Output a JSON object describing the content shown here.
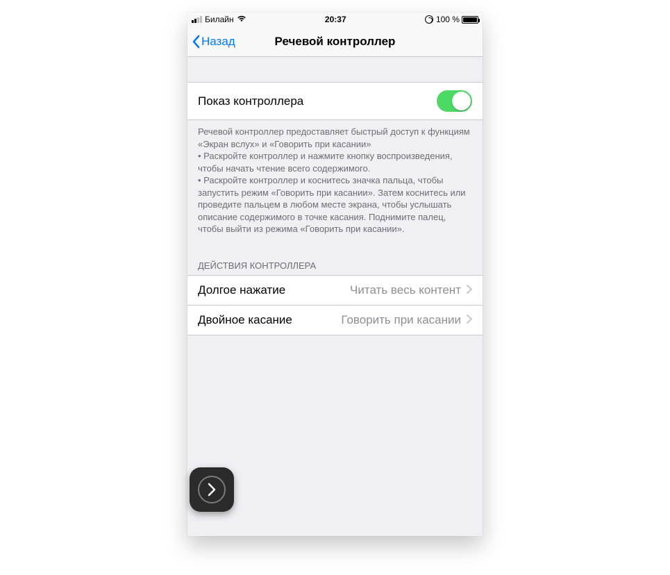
{
  "status": {
    "carrier": "Билайн",
    "time": "20:37",
    "battery_text": "100 %"
  },
  "nav": {
    "back": "Назад",
    "title": "Речевой контроллер"
  },
  "toggle": {
    "label": "Показ контроллера",
    "on": true
  },
  "description": "Речевой контроллер предоставляет быстрый доступ к функциям «Экран вслух» и «Говорить при касании»\n • Раскройте контроллер и нажмите кнопку воспроизведения, чтобы начать чтение всего содержимого.\n • Раскройте контроллер и коснитесь значка пальца, чтобы запустить режим «Говорить при касании». Затем коснитесь или проведите пальцем в любом месте экрана, чтобы услышать описание содержимого в точке касания. Поднимите палец, чтобы выйти из режима «Говорить при касании».",
  "section_header": "ДЕЙСТВИЯ КОНТРОЛЛЕРА",
  "actions": [
    {
      "label": "Долгое нажатие",
      "value": "Читать весь контент"
    },
    {
      "label": "Двойное касание",
      "value": "Говорить при касании"
    }
  ]
}
